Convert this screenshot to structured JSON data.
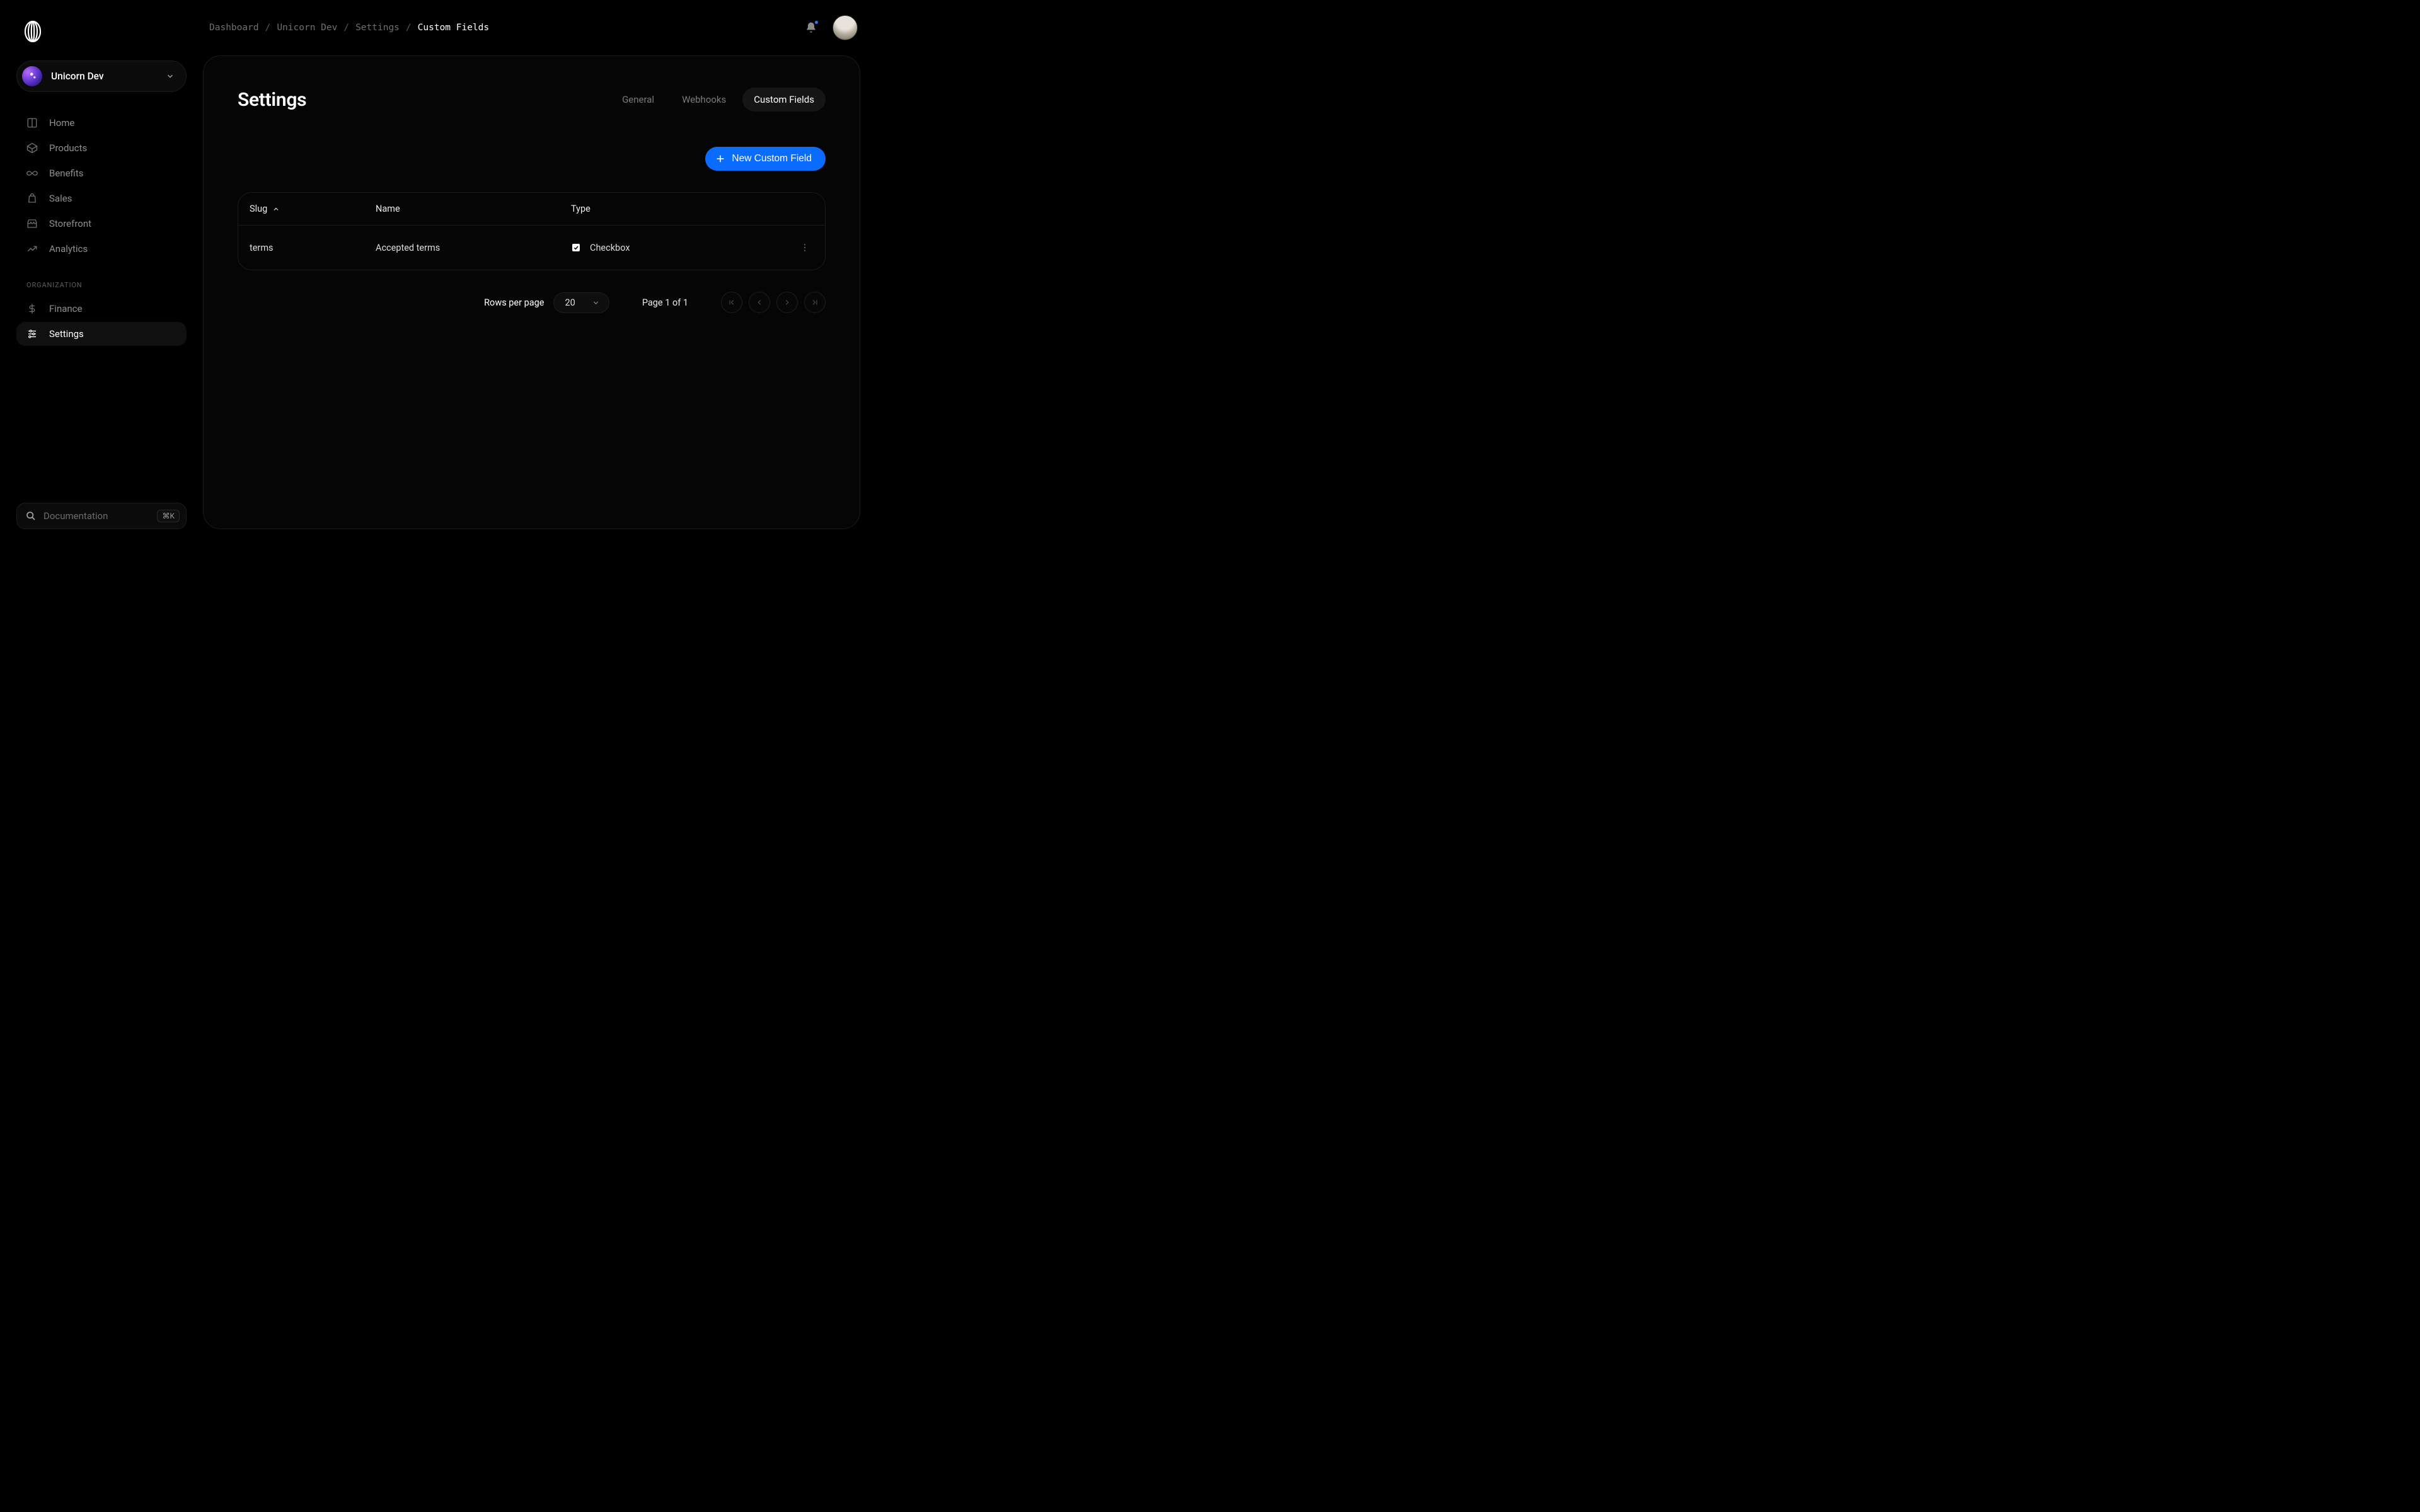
{
  "org": {
    "name": "Unicorn Dev"
  },
  "breadcrumb": {
    "items": [
      "Dashboard",
      "Unicorn Dev",
      "Settings"
    ],
    "current": "Custom Fields"
  },
  "sidebar": {
    "items": [
      {
        "label": "Home",
        "icon": "layout-icon"
      },
      {
        "label": "Products",
        "icon": "cube-icon"
      },
      {
        "label": "Benefits",
        "icon": "infinity-icon"
      },
      {
        "label": "Sales",
        "icon": "bag-icon"
      },
      {
        "label": "Storefront",
        "icon": "storefront-icon"
      },
      {
        "label": "Analytics",
        "icon": "trend-icon"
      }
    ],
    "section_label": "Organization",
    "org_items": [
      {
        "label": "Finance",
        "icon": "dollar-icon",
        "active": false
      },
      {
        "label": "Settings",
        "icon": "sliders-icon",
        "active": true
      }
    ],
    "doc_label": "Documentation",
    "doc_kbd": "⌘K"
  },
  "page": {
    "title": "Settings",
    "tabs": [
      {
        "label": "General",
        "active": false
      },
      {
        "label": "Webhooks",
        "active": false
      },
      {
        "label": "Custom Fields",
        "active": true
      }
    ],
    "primary_action": "New Custom Field"
  },
  "table": {
    "columns": [
      "Slug",
      "Name",
      "Type"
    ],
    "sort_column": "Slug",
    "rows": [
      {
        "slug": "terms",
        "name": "Accepted terms",
        "type": "Checkbox"
      }
    ]
  },
  "pagination": {
    "rows_per_page_label": "Rows per page",
    "rows_per_page_value": "20",
    "page_info": "Page 1 of 1"
  }
}
